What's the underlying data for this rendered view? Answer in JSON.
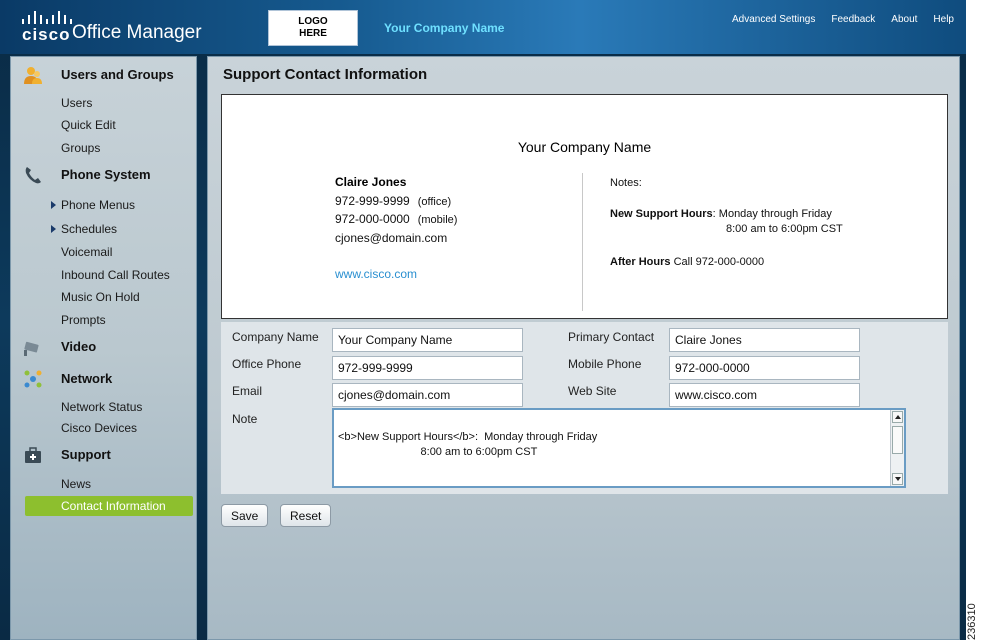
{
  "header": {
    "brand": "cisco",
    "app_title": "Office Manager",
    "logo_text": "LOGO HERE",
    "company_name": "Your Company Name",
    "links": [
      "Advanced Settings",
      "Feedback",
      "About",
      "Help"
    ]
  },
  "sidebar": {
    "sections": [
      {
        "title": "Users and Groups",
        "icon": "users-icon",
        "items": [
          "Users",
          "Quick Edit",
          "Groups"
        ]
      },
      {
        "title": "Phone System",
        "icon": "phone-icon",
        "items": [
          "Phone Menus",
          "Schedules",
          "Voicemail",
          "Inbound Call Routes",
          "Music On Hold",
          "Prompts"
        ]
      },
      {
        "title": "Video",
        "icon": "video-camera-icon",
        "items": []
      },
      {
        "title": "Network",
        "icon": "network-icon",
        "items": [
          "Network Status",
          "Cisco Devices"
        ]
      },
      {
        "title": "Support",
        "icon": "support-kit-icon",
        "items": [
          "News",
          "Contact Information"
        ]
      }
    ],
    "active_item": "Contact Information"
  },
  "main": {
    "page_title": "Support Contact Information",
    "preview": {
      "company": "Your Company Name",
      "contact_name": "Claire Jones",
      "office_phone": "972-999-9999",
      "office_tag": "(office)",
      "mobile_phone": "972-000-0000",
      "mobile_tag": "(mobile)",
      "email": "cjones@domain.com",
      "website": "www.cisco.com",
      "notes_label": "Notes:",
      "support_hours_label": "New Support Hours",
      "support_hours_line1": ":  Monday through Friday",
      "support_hours_line2": "8:00 am to 6:00pm CST",
      "after_hours_label": "After Hours",
      "after_hours_text": " Call 972-000-0000"
    },
    "form": {
      "company_name_label": "Company Name",
      "company_name_value": "Your Company Name",
      "primary_contact_label": "Primary Contact",
      "primary_contact_value": "Claire Jones",
      "office_phone_label": "Office Phone",
      "office_phone_value": "972-999-9999",
      "mobile_phone_label": "Mobile Phone",
      "mobile_phone_value": "972-000-0000",
      "email_label": "Email",
      "email_value": "cjones@domain.com",
      "website_label": "Web Site",
      "website_value": "www.cisco.com",
      "note_label": "Note",
      "note_value": "<b>New Support Hours</b>:  Monday through Friday\n                           8:00 am to 6:00pm CST"
    },
    "buttons": {
      "save": "Save",
      "reset": "Reset"
    }
  },
  "figure_id": "236310"
}
